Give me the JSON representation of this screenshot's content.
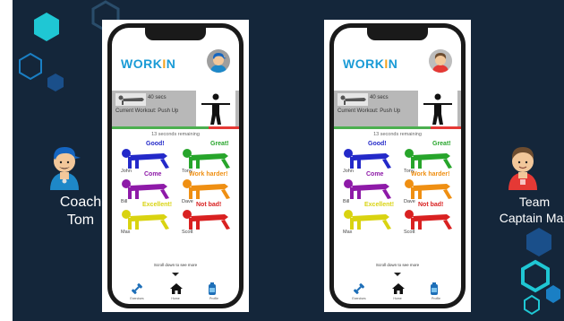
{
  "slide": {
    "background": "#14263a",
    "accent_cyan": "#1fc7d4",
    "accent_blue": "#1a7fc4"
  },
  "coach": {
    "label": "Coach Tom",
    "line1": "Coach",
    "line2": "Tom",
    "icon": "coach-avatar-icon"
  },
  "captain": {
    "label": "Team Captain Max",
    "line1": "Team",
    "line2": "Captain Max",
    "icon": "captain-avatar-icon"
  },
  "phones": [
    {
      "logo_prefix": "WORK",
      "logo_i": "I",
      "logo_suffix": "N",
      "profile_icon": "coach-profile-icon",
      "workout": {
        "secs": "40 secs",
        "current": "Current Workout: Push Up"
      },
      "remaining": "13 seconds remaining",
      "progress": 0.76,
      "members": [
        {
          "name": "John",
          "cheer": "Good!",
          "color": "#2329c9"
        },
        {
          "name": "Tony",
          "cheer": "Great!",
          "color": "#27a52b"
        },
        {
          "name": "Bill",
          "cheer": "Come",
          "color": "#8e1aa8"
        },
        {
          "name": "Dave",
          "cheer": "Work harder!",
          "color": "#ef8f12"
        },
        {
          "name": "Max",
          "cheer": "Excellent!",
          "color": "#d9d310"
        },
        {
          "name": "Scott",
          "cheer": "Not bad!",
          "color": "#d92121"
        }
      ],
      "scroll_hint": "Scroll down to see more",
      "nav": [
        {
          "label": "Exercises",
          "icon": "dumbbell-icon"
        },
        {
          "label": "Home",
          "icon": "home-icon"
        },
        {
          "label": "Profile",
          "icon": "bottle-icon"
        }
      ]
    },
    {
      "logo_prefix": "WORK",
      "logo_i": "I",
      "logo_suffix": "N",
      "profile_icon": "captain-profile-icon",
      "workout": {
        "secs": "40 secs",
        "current": "Current Workout: Push Up"
      },
      "remaining": "13 seconds remaining",
      "progress": 0.76,
      "members": [
        {
          "name": "John",
          "cheer": "Good!",
          "color": "#2329c9"
        },
        {
          "name": "Tony",
          "cheer": "Great!",
          "color": "#27a52b"
        },
        {
          "name": "Bill",
          "cheer": "Come",
          "color": "#8e1aa8"
        },
        {
          "name": "Dave",
          "cheer": "Work harder!",
          "color": "#ef8f12"
        },
        {
          "name": "Max",
          "cheer": "Excellent!",
          "color": "#d9d310"
        },
        {
          "name": "Scott",
          "cheer": "Not bad!",
          "color": "#d92121"
        }
      ],
      "scroll_hint": "Scroll down to see more",
      "nav": [
        {
          "label": "Exercises",
          "icon": "dumbbell-icon"
        },
        {
          "label": "Home",
          "icon": "home-icon"
        },
        {
          "label": "Profile",
          "icon": "bottle-icon"
        }
      ]
    }
  ]
}
